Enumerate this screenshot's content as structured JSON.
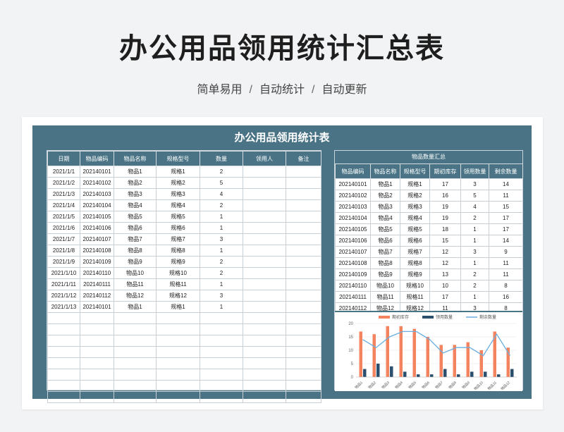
{
  "page": {
    "title": "办公用品领用统计汇总表",
    "subtitle_parts": [
      "简单易用",
      "自动统计",
      "自动更新"
    ],
    "separator": "/"
  },
  "sheet": {
    "title": "办公用品领用统计表",
    "left_headers": [
      "日期",
      "物品编码",
      "物品名称",
      "规格型号",
      "数量",
      "领用人",
      "备注"
    ],
    "left_rows": [
      [
        "2021/1/1",
        "202140101",
        "物品1",
        "规格1",
        "2",
        "",
        ""
      ],
      [
        "2021/1/2",
        "202140102",
        "物品2",
        "规格2",
        "5",
        "",
        ""
      ],
      [
        "2021/1/3",
        "202140103",
        "物品3",
        "规格3",
        "4",
        "",
        ""
      ],
      [
        "2021/1/4",
        "202140104",
        "物品4",
        "规格4",
        "2",
        "",
        ""
      ],
      [
        "2021/1/5",
        "202140105",
        "物品5",
        "规格5",
        "1",
        "",
        ""
      ],
      [
        "2021/1/6",
        "202140106",
        "物品6",
        "规格6",
        "1",
        "",
        ""
      ],
      [
        "2021/1/7",
        "202140107",
        "物品7",
        "规格7",
        "3",
        "",
        ""
      ],
      [
        "2021/1/8",
        "202140108",
        "物品8",
        "规格8",
        "1",
        "",
        ""
      ],
      [
        "2021/1/9",
        "202140109",
        "物品9",
        "规格9",
        "2",
        "",
        ""
      ],
      [
        "2021/1/10",
        "202140110",
        "物品10",
        "规格10",
        "2",
        "",
        ""
      ],
      [
        "2021/1/11",
        "202140111",
        "物品11",
        "规格11",
        "1",
        "",
        ""
      ],
      [
        "2021/1/12",
        "202140112",
        "物品12",
        "规格12",
        "3",
        "",
        ""
      ],
      [
        "2021/1/13",
        "202140101",
        "物品1",
        "规格1",
        "1",
        "",
        ""
      ]
    ],
    "left_empty_rows": 8,
    "summary_title": "物品数量汇总",
    "summary_headers": [
      "物品编码",
      "物品名称",
      "规格型号",
      "期初库存",
      "领用数量",
      "剩余数量"
    ],
    "summary_rows": [
      [
        "202140101",
        "物品1",
        "规格1",
        "17",
        "3",
        "14"
      ],
      [
        "202140102",
        "物品2",
        "规格2",
        "16",
        "5",
        "11"
      ],
      [
        "202140103",
        "物品3",
        "规格3",
        "19",
        "4",
        "15"
      ],
      [
        "202140104",
        "物品4",
        "规格4",
        "19",
        "2",
        "17"
      ],
      [
        "202140105",
        "物品5",
        "规格5",
        "18",
        "1",
        "17"
      ],
      [
        "202140106",
        "物品6",
        "规格6",
        "15",
        "1",
        "14"
      ],
      [
        "202140107",
        "物品7",
        "规格7",
        "12",
        "3",
        "9"
      ],
      [
        "202140108",
        "物品8",
        "规格8",
        "12",
        "1",
        "11"
      ],
      [
        "202140109",
        "物品9",
        "规格9",
        "13",
        "2",
        "11"
      ],
      [
        "202140110",
        "物品10",
        "规格10",
        "10",
        "2",
        "8"
      ],
      [
        "202140111",
        "物品11",
        "规格11",
        "17",
        "1",
        "16"
      ],
      [
        "202140112",
        "物品12",
        "规格12",
        "11",
        "3",
        "8"
      ]
    ]
  },
  "colors": {
    "header_bg": "#4a7486",
    "bar_initial": "#f4845f",
    "bar_used": "#2d4f6e",
    "line_remaining": "#6aaee0"
  },
  "chart_data": {
    "type": "bar",
    "categories": [
      "物品1",
      "物品2",
      "物品3",
      "物品4",
      "物品5",
      "物品6",
      "物品7",
      "物品8",
      "物品9",
      "物品10",
      "物品11",
      "物品12"
    ],
    "series": [
      {
        "name": "期初库存",
        "type": "bar",
        "values": [
          17,
          16,
          19,
          19,
          18,
          15,
          12,
          12,
          13,
          10,
          17,
          11
        ]
      },
      {
        "name": "领用数量",
        "type": "bar",
        "values": [
          3,
          5,
          4,
          2,
          1,
          1,
          3,
          1,
          2,
          2,
          1,
          3
        ]
      },
      {
        "name": "剩余数量",
        "type": "line",
        "values": [
          14,
          11,
          15,
          17,
          17,
          14,
          9,
          11,
          11,
          8,
          16,
          8
        ]
      }
    ],
    "y_ticks": [
      "0",
      "5",
      "10",
      "15",
      "20"
    ],
    "ylim": [
      0,
      20
    ],
    "legend": "top",
    "grid": true
  }
}
